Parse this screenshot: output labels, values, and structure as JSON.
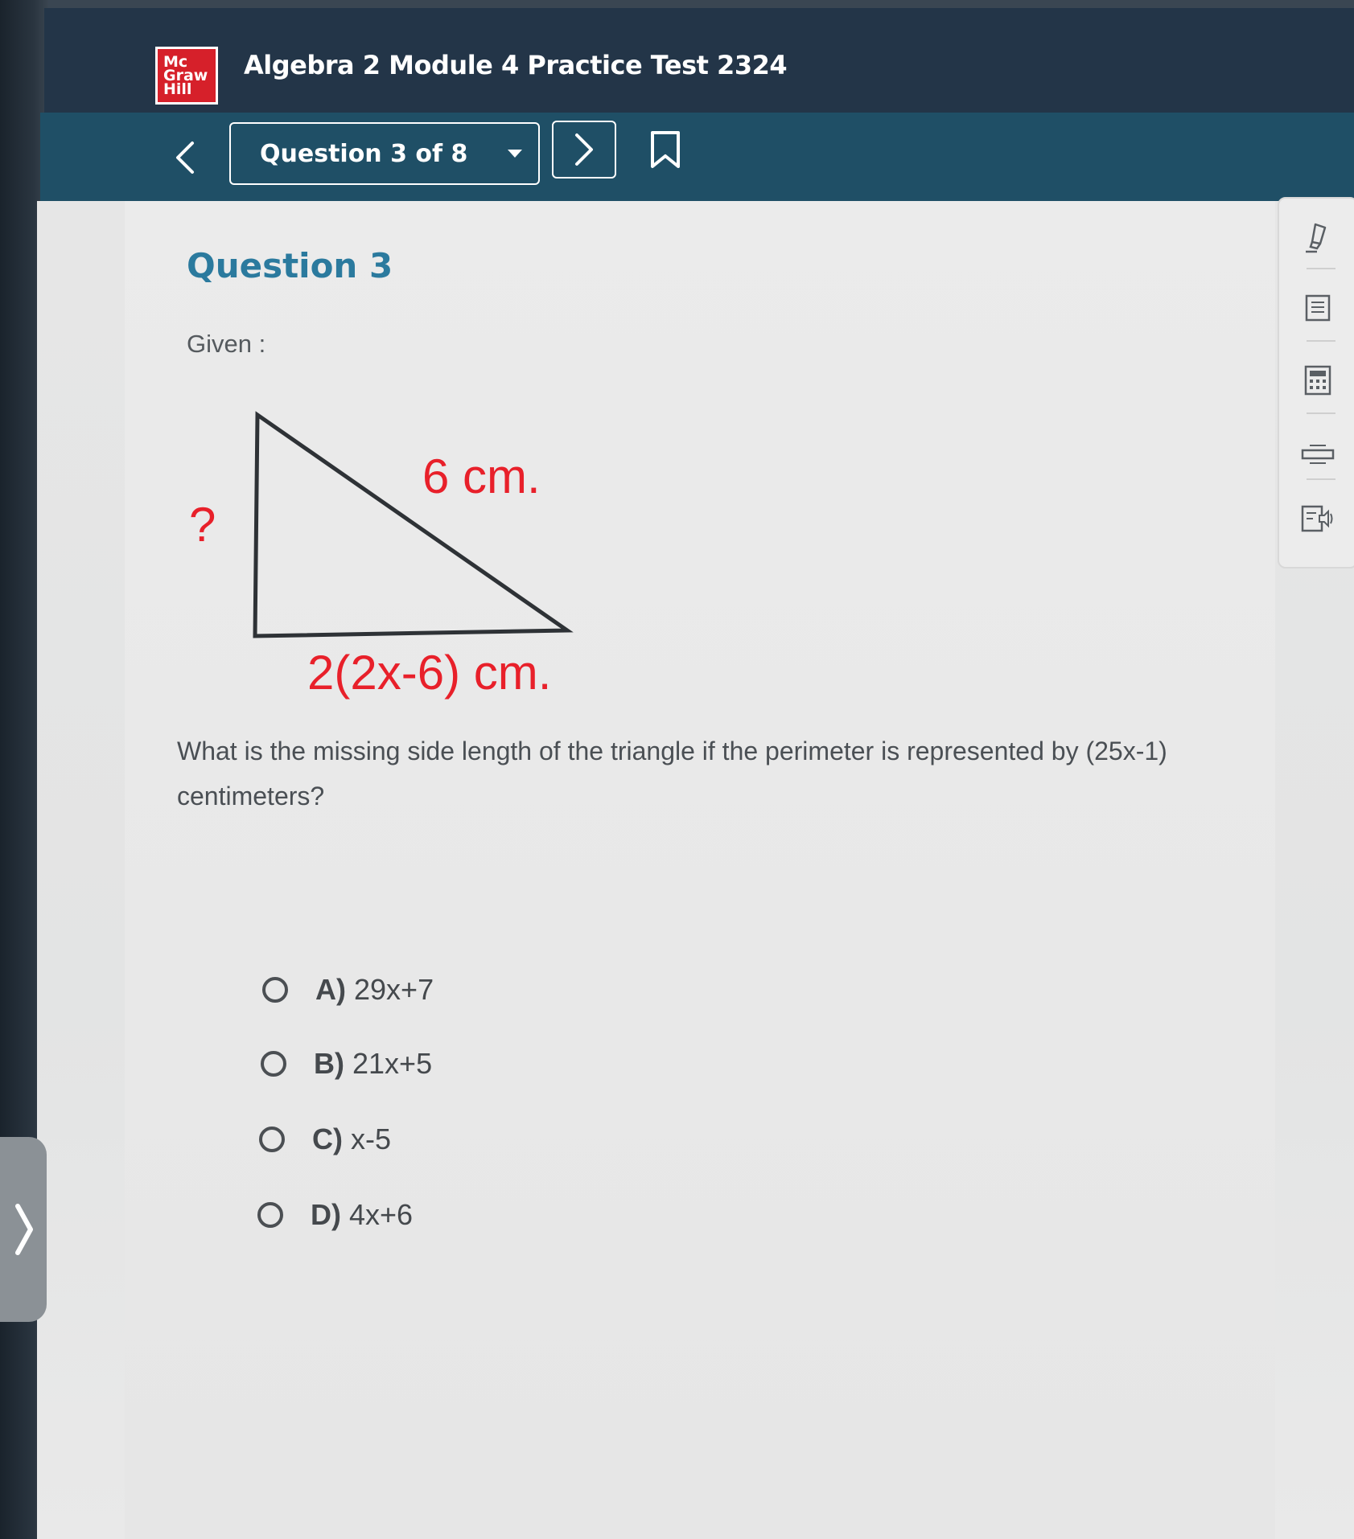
{
  "header": {
    "logo": {
      "line1": "Mc",
      "line2": "Graw",
      "line3": "Hill"
    },
    "title": "Algebra 2 Module 4 Practice Test 2324"
  },
  "nav": {
    "question_selector": "Question 3 of 8"
  },
  "question": {
    "heading": "Question 3",
    "given": "Given :",
    "figure": {
      "side_unknown": "?",
      "side_hypotenuse": "6 cm.",
      "side_base": "2(2x-6) cm."
    },
    "prompt": "What is the missing side length of the triangle if the perimeter is represented by (25x-1) centimeters?",
    "choices": [
      {
        "letter": "A)",
        "text": "29x+7"
      },
      {
        "letter": "B)",
        "text": "21x+5"
      },
      {
        "letter": "C)",
        "text": "x-5"
      },
      {
        "letter": "D)",
        "text": "4x+6"
      }
    ]
  },
  "tools": [
    "highlighter-icon",
    "notes-icon",
    "calculator-icon",
    "line-reader-icon",
    "text-to-speech-icon"
  ],
  "colors": {
    "header_bg": "#233548",
    "nav_bg": "#1f4f66",
    "heading": "#2b7a9e",
    "figure_label": "#e8202a",
    "logo_red": "#d6202a"
  }
}
